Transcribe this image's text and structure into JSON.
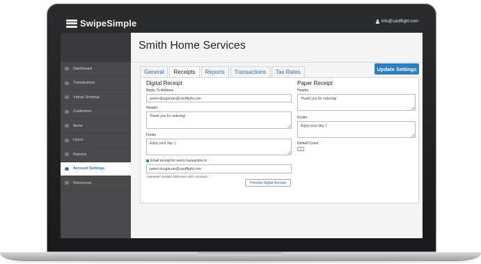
{
  "app": {
    "logo_text": "SwipeSimple",
    "user_email": "info@cardflight.com"
  },
  "sidebar": {
    "items": [
      {
        "label": "Dashboard",
        "icon": "home-icon"
      },
      {
        "label": "Transactions",
        "icon": "transactions-icon"
      },
      {
        "label": "Virtual Terminal",
        "icon": "terminal-icon"
      },
      {
        "label": "Customers",
        "icon": "customers-icon"
      },
      {
        "label": "Items",
        "icon": "tag-icon"
      },
      {
        "label": "Users",
        "icon": "users-icon"
      },
      {
        "label": "Reports",
        "icon": "chart-icon"
      },
      {
        "label": "Account Settings",
        "icon": "gear-icon",
        "active": true
      },
      {
        "label": "Resources",
        "icon": "document-icon"
      }
    ]
  },
  "main": {
    "title": "Smith Home Services",
    "tabs": [
      "General",
      "Receipts",
      "Reports",
      "Transactions",
      "Tax Rates"
    ],
    "active_tab": "Receipts",
    "update_button": "Update Settings"
  },
  "digital_receipt": {
    "title": "Digital Receipt",
    "reply_to_label": "Reply-To Address",
    "reply_to_value": "peter+doughnuts@cardflight.com",
    "header_label": "Header",
    "header_value": "Thank you for ordering!",
    "footer_label": "Footer",
    "footer_value": "Enjoy your day :)",
    "email_checkbox_label": "Email receipt for every transaction to",
    "email_value": "peter+doughnuts@cardflight.com",
    "email_hint": "(separate multiple addresses with commas)",
    "preview_button": "Preview Digital Receipt"
  },
  "paper_receipt": {
    "title": "Paper Receipt",
    "header_label": "Header",
    "header_value": "Thank you for ordering!",
    "footer_label": "Footer",
    "footer_value": "Enjoy your day :)",
    "default_count_label": "Default Count",
    "default_count_value": "1"
  },
  "colors": {
    "accent": "#2f7ec1",
    "topbar": "#2a2b2d",
    "sidebar": "#4a4a4c"
  }
}
